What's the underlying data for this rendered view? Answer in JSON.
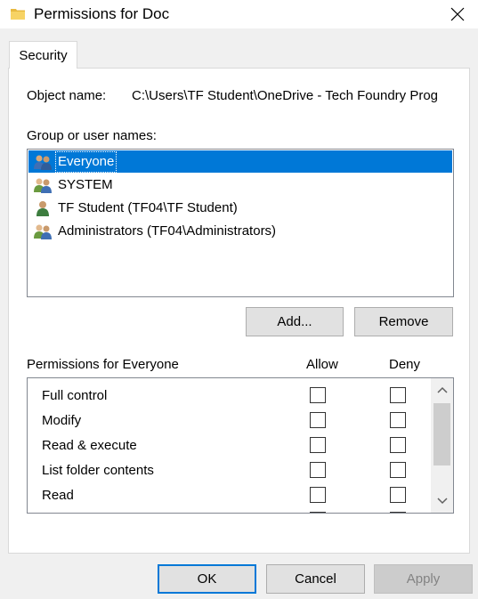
{
  "window": {
    "title": "Permissions for Doc",
    "close_icon": "close-icon",
    "folder_icon": "folder-icon"
  },
  "tabs": [
    {
      "label": "Security",
      "selected": true
    }
  ],
  "object": {
    "label": "Object name:",
    "value": "C:\\Users\\TF Student\\OneDrive - Tech Foundry Prog"
  },
  "groups": {
    "label": "Group or user names:",
    "items": [
      {
        "name": "Everyone",
        "icon": "users-group-icon",
        "selected": true
      },
      {
        "name": "SYSTEM",
        "icon": "users-group-icon",
        "selected": false
      },
      {
        "name": "TF Student (TF04\\TF Student)",
        "icon": "user-icon",
        "selected": false
      },
      {
        "name": "Administrators (TF04\\Administrators)",
        "icon": "users-group-icon",
        "selected": false
      }
    ]
  },
  "buttons": {
    "add": "Add...",
    "remove": "Remove",
    "ok": "OK",
    "cancel": "Cancel",
    "apply": "Apply"
  },
  "permissions": {
    "label": "Permissions for Everyone",
    "allow_header": "Allow",
    "deny_header": "Deny",
    "items": [
      {
        "name": "Full control",
        "allow": false,
        "deny": false
      },
      {
        "name": "Modify",
        "allow": false,
        "deny": false
      },
      {
        "name": "Read & execute",
        "allow": false,
        "deny": false
      },
      {
        "name": "List folder contents",
        "allow": false,
        "deny": false
      },
      {
        "name": "Read",
        "allow": false,
        "deny": false
      }
    ]
  },
  "colors": {
    "selection": "#0078d7",
    "primary_border": "#0078d7"
  }
}
